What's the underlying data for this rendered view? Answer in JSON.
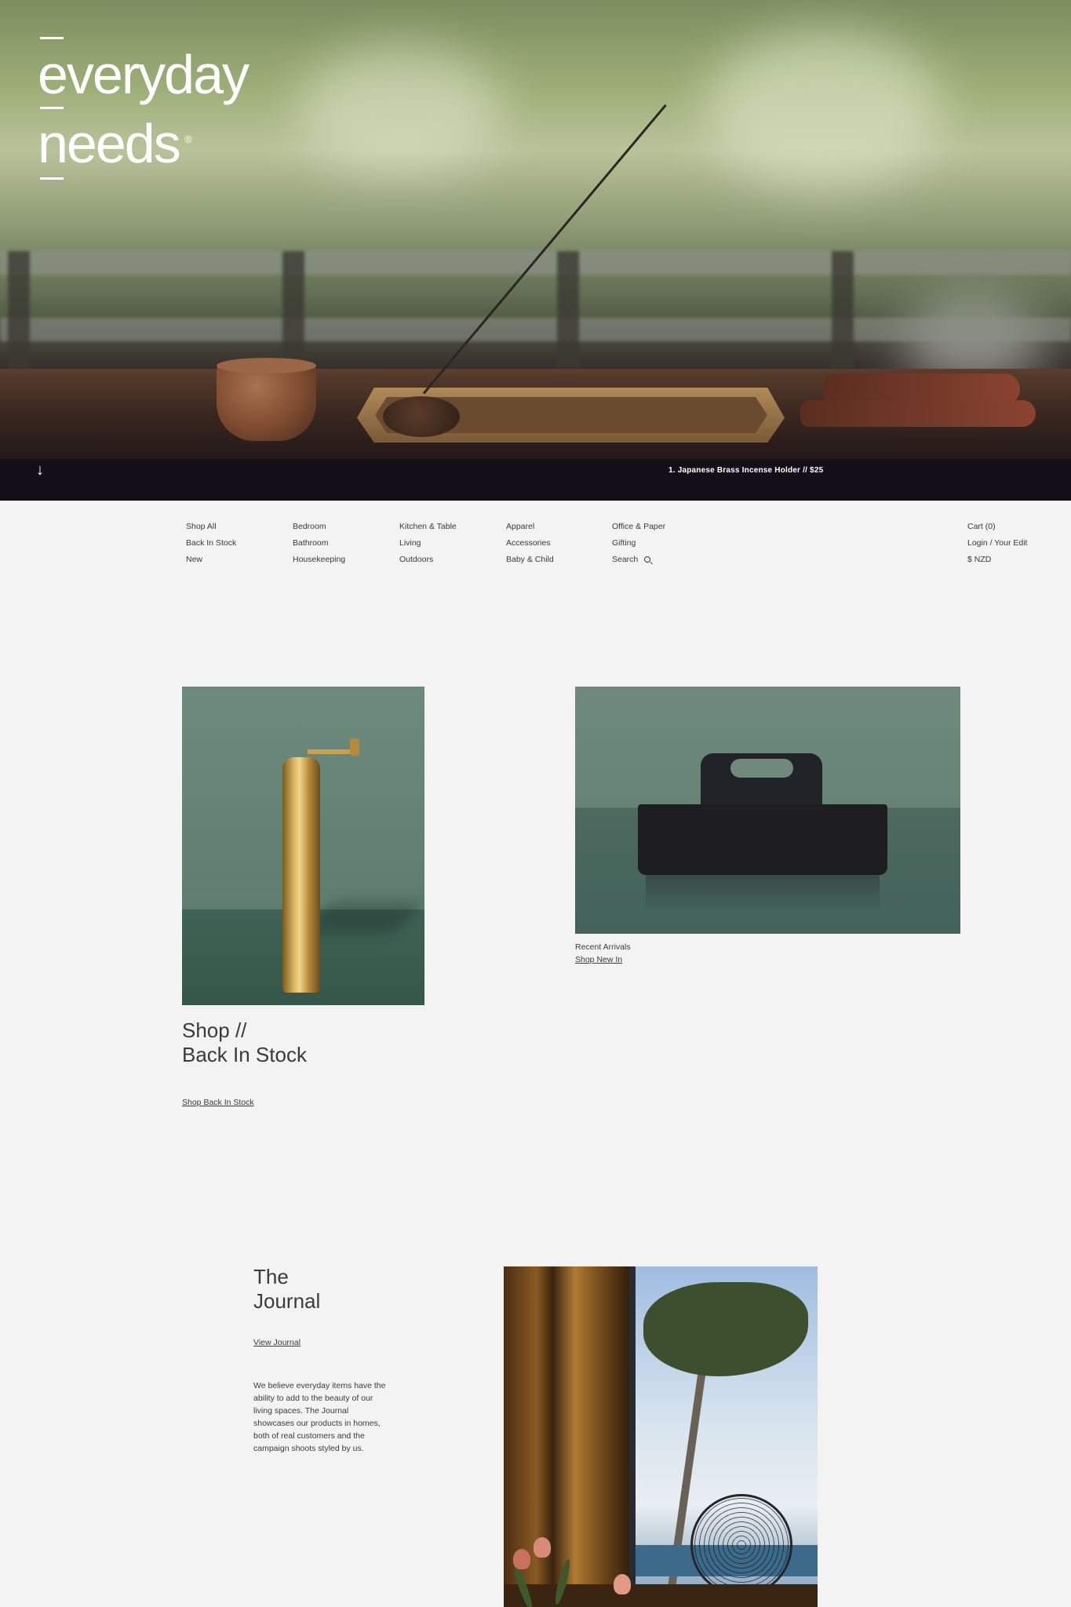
{
  "brand": {
    "line1": "everyday",
    "line2": "needs",
    "registered": "®"
  },
  "hero": {
    "scroll_arrow": "↓",
    "caption": "1. Japanese Brass Incense Holder // $25"
  },
  "nav": {
    "col1": [
      "Shop All",
      "Back In Stock",
      "New"
    ],
    "col2": [
      "Bedroom",
      "Bathroom",
      "Housekeeping"
    ],
    "col3": [
      "Kitchen & Table",
      "Living",
      "Outdoors"
    ],
    "col4": [
      "Apparel",
      "Accessories",
      "Baby & Child"
    ],
    "col5": [
      "Office & Paper",
      "Gifting",
      "Search"
    ],
    "account": [
      "Cart (0)",
      "Login / Your Edit",
      "$ NZD"
    ]
  },
  "feature_back_in_stock": {
    "heading_line1": "Shop //",
    "heading_line2": "Back In Stock",
    "link": "Shop Back In Stock"
  },
  "feature_new": {
    "label": "Recent Arrivals",
    "link": "Shop New In"
  },
  "journal": {
    "heading_line1": "The",
    "heading_line2": "Journal",
    "link": "View Journal",
    "body": "We believe everyday items have the ability to add to the beauty of our living spaces. The Journal showcases our products in homes, both of real customers and the campaign shoots styled by us."
  },
  "icons": {
    "scroll": "arrow-down-icon",
    "search": "search-icon"
  }
}
